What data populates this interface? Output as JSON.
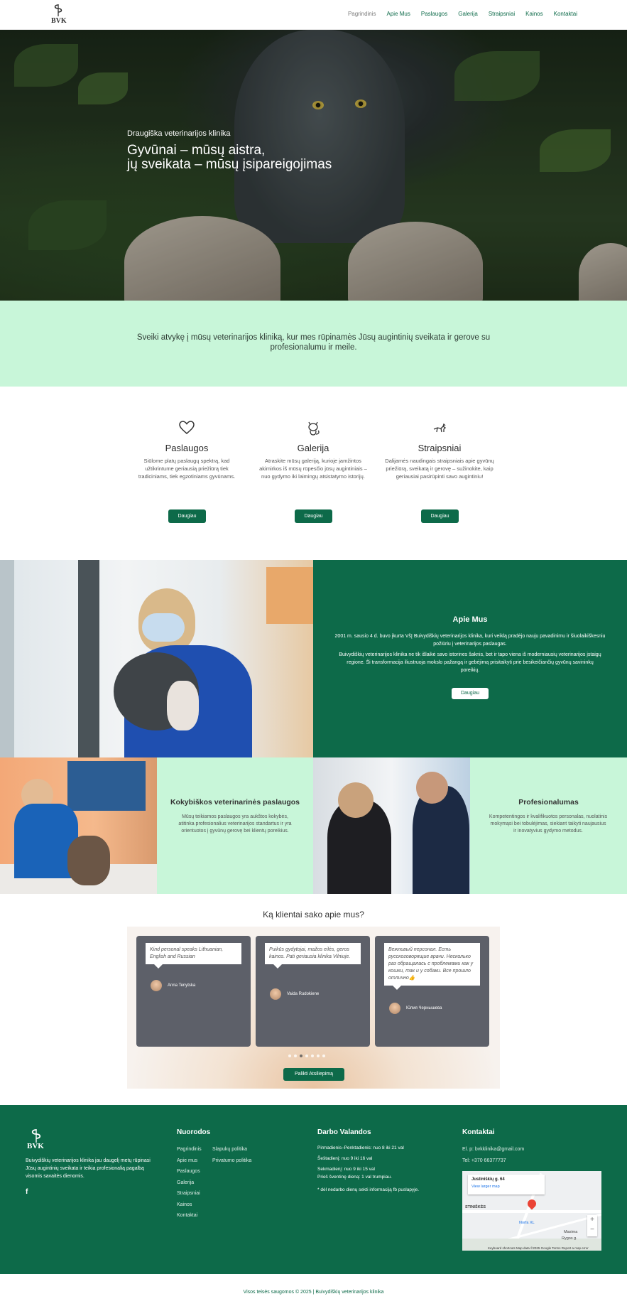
{
  "header": {
    "nav": [
      {
        "label": "Pagrindinis",
        "active": true
      },
      {
        "label": "Apie Mus"
      },
      {
        "label": "Paslaugos"
      },
      {
        "label": "Galerija"
      },
      {
        "label": "Straipsniai"
      },
      {
        "label": "Kainos"
      },
      {
        "label": "Kontaktai"
      }
    ]
  },
  "hero": {
    "subtitle": "Draugiška veterinarijos klinika",
    "title_line1": "Gyvūnai – mūsų aistra,",
    "title_line2": "jų sveikata – mūsų įsipareigojimas"
  },
  "welcome": {
    "text": "Sveiki atvykę į mūsų veterinarijos kliniką, kur mes rūpinamės Jūsų augintinių sveikata ir gerove su profesionalumu ir meile."
  },
  "features": [
    {
      "icon": "heart-icon",
      "title": "Paslaugos",
      "text": "Siūlome platų paslaugų spektrą, kad užtikrintume geriausią priežiūrą tiek tradiciniams, tiek egzotiniams gyvūnams.",
      "button": "Daugiau"
    },
    {
      "icon": "cat-icon",
      "title": "Galerija",
      "text": "Atraskite mūsų galeriją, kurioje įamžintos akimirkos iš mūsų rūpesčio jūsų augintiniais – nuo gydymo iki laimingų atsistatymo istorijų.",
      "button": "Daugiau"
    },
    {
      "icon": "dog-icon",
      "title": "Straipsniai",
      "text": "Dalijamės naudingais straipsniais apie gyvūnų priežiūrą, sveikatą ir gerovę – sužinokite, kaip geriausiai pasirūpinti savo augintiniu!",
      "button": "Daugiau"
    }
  ],
  "about": {
    "title": "Apie Mus",
    "p1": "2001 m. sausio 4 d. buvo įkurta VšĮ Buivydiškių veterinarijos klinika, kuri veiklą pradėjo nauju pavadinimu ir šiuolaikiškesniu požiūriu į veterinarijos paslaugas.",
    "p2": "Buivydiškių veterinarijos klinika ne tik išlaikė savo istorines šaknis, bet ir tapo viena iš moderniausių veterinarijos įstaigų regione. Ši transformacija iliustruoja mokslo pažangą ir gebėjimą prisitaikyti prie besikeičiančių gyvūnų savininkų poreikių.",
    "button": "Daugiau"
  },
  "quality": {
    "title": "Kokybiškos veterinarinės paslaugos",
    "text": "Mūsų teikiamos paslaugos yra aukštos kokybės, atitinka profesionalius veterinarijos standartus ir yra orientuotos į gyvūnų gerovę bei klientų poreikius."
  },
  "professional": {
    "title": "Profesionalumas",
    "text": "Kompetentingos ir kvalifikuotos personalas, nuolatinis mokymąsi bei tobulėjimas, siekiant taikyti naujausius ir inovatyvius gydymo metodus."
  },
  "testimonials": {
    "title": "Ką klientai sako apie mus?",
    "items": [
      {
        "quote": "Kind personal speaks Lithuanian, English and Russian",
        "name": "Anna Tenytska"
      },
      {
        "quote": "Puikūs gydytojai, mažos eilės, geros kainos. Pati geriausia klinika Vilniuje.",
        "name": "Vaida Rudokiene"
      },
      {
        "quote": "Вежливый персонал. Есть русскоговорящие врачи. Несколько раз обращалась с проблемами как у кошки, так и у собаки. Все прошло отлично👍",
        "name": "Юлия Чернышева"
      }
    ],
    "button": "Palikti Atsiliepimą"
  },
  "footer": {
    "description": "Buivydiškių veterinarijos klinika jau daugelį metų rūpinasi Jūsų augintinių sveikata ir teikia profesionalią pagalbą visomis savaitės dienomis.",
    "nav_title": "Nuorodos",
    "links_col1": [
      "Pagrindinis",
      "Apie mus",
      "Paslaugos",
      "Galerija",
      "Straipsniai",
      "Kainos",
      "Kontaktai"
    ],
    "links_col2": [
      "Slapukų politika",
      "Privatumo politika"
    ],
    "hours_title": "Darbo Valandos",
    "hours": [
      "Pirmadienis–Penktadienis: nuo 8 iki 21 val",
      "Šeštadienį: nuo 9 iki 16 val",
      "Sekmadienį: nuo 9 iki 15 val",
      "Prieš šventinę dieną: 1 val trumpiau.",
      "* dėl nedarbo dienų sekti informaciją fb puslapyje."
    ],
    "contact_title": "Kontaktai",
    "email": "El. p: bvkklinika@gmail.com",
    "phone": "Tel: +370 66377737",
    "map": {
      "place": "Justiniškių g. 64",
      "link": "View larger map",
      "labels": [
        "STINIŠKĖS",
        "Norfa XL",
        "Maxima",
        "Rygos g."
      ],
      "attribution": "Keyboard shortcuts   Map data ©2025 Google   Terms   Report a map error"
    },
    "copyright": "Visos teisės saugomos © 2025 | Buivydiškių veterinarijos klinika"
  }
}
